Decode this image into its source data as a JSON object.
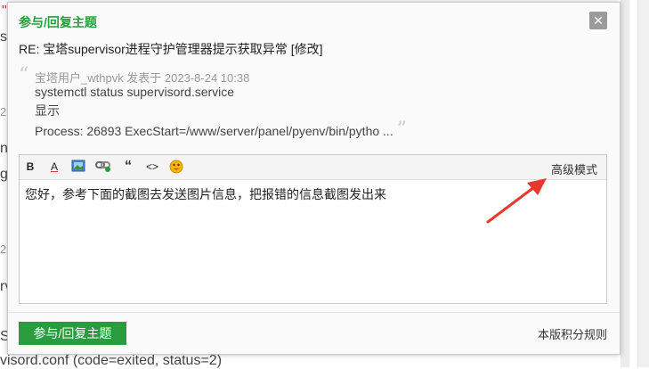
{
  "background": {
    "frag_quote": "\"",
    "frag_s": "s",
    "frag_2a": "2",
    "frag_2b": "2",
    "frag_2c": "2",
    "frag_nc": "nc",
    "frag_g": "g",
    "frag_rv": "rv",
    "frag_S": "S",
    "frag_bottom": "visord.conf (code=exited, status=2)"
  },
  "modal": {
    "title": "参与/回复主题",
    "close_icon": "✕",
    "subject": "RE: 宝塔supervisor进程守护管理器提示获取异常 [修改]",
    "quote": {
      "meta": "宝塔用户_wthpvk 发表于 2023-8-24 10:38",
      "lines": [
        "systemctl status supervisord.service",
        "显示",
        "Process: 26893 ExecStart=/www/server/panel/pyenv/bin/pytho ..."
      ]
    },
    "toolbar": {
      "bold": "B",
      "font_color": "A",
      "quote": "“",
      "code": "<>",
      "advanced_mode": "高级模式"
    },
    "editor_text": "您好，参考下面的截图去发送图片信息，把报错的信息截图发出来",
    "submit_label": "参与/回复主题",
    "rules_link": "本版积分规则"
  },
  "colors": {
    "accent_green": "#2a9c3f",
    "annotation_red": "#e8372c"
  }
}
